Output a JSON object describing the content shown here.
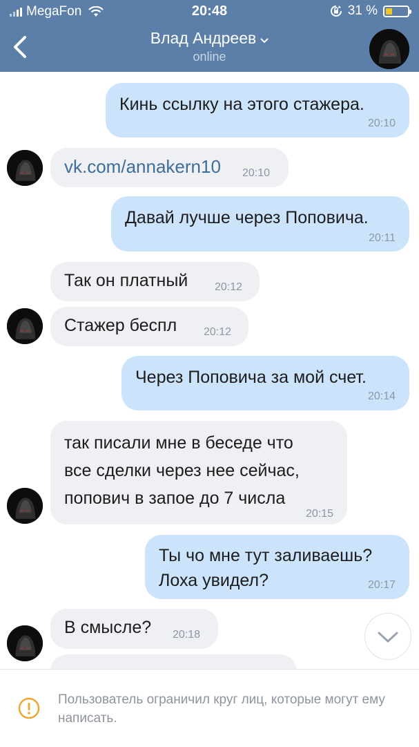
{
  "status_bar": {
    "carrier": "MegaFon",
    "time": "20:48",
    "battery": "31 %"
  },
  "header": {
    "name": "Влад Андреев",
    "status": "online"
  },
  "messages": [
    {
      "dir": "out",
      "text": "Кинь ссылку на этого стажера.",
      "time": "20:10"
    },
    {
      "dir": "in",
      "text": "vk.com/annakern10",
      "time": "20:10",
      "link": true
    },
    {
      "dir": "out",
      "text": "Давай лучше через Поповича.",
      "time": "20:11"
    },
    {
      "dir": "in",
      "text": "Так он платный",
      "time": "20:12"
    },
    {
      "dir": "in",
      "text": "Стажер беспл",
      "time": "20:12"
    },
    {
      "dir": "out",
      "text": "Через Поповича за мой счет.",
      "time": "20:14"
    },
    {
      "dir": "in",
      "text": "так писали мне в беседе что\nвсе сделки через нее сейчас,\nпопович в запое до 7 числа",
      "time": "20:15"
    },
    {
      "dir": "out",
      "text": "Ты чо мне тут заливаешь?\nЛоха увидел?",
      "time": "20:17"
    },
    {
      "dir": "in",
      "text": "В смысле?",
      "time": "20:18"
    }
  ],
  "footer": {
    "notice": "Пользователь ограничил круг лиц, которые могут ему написать."
  },
  "colors": {
    "header": "#5b7fa8",
    "out_bubble": "#cce4fb",
    "in_bubble": "#eef0f3",
    "link": "#3f6d9a"
  },
  "icons": [
    "signal-icon",
    "wifi-icon",
    "orientation-lock-icon",
    "battery-icon",
    "back-arrow-icon",
    "chevron-down-icon",
    "scroll-down-icon",
    "warning-icon"
  ]
}
